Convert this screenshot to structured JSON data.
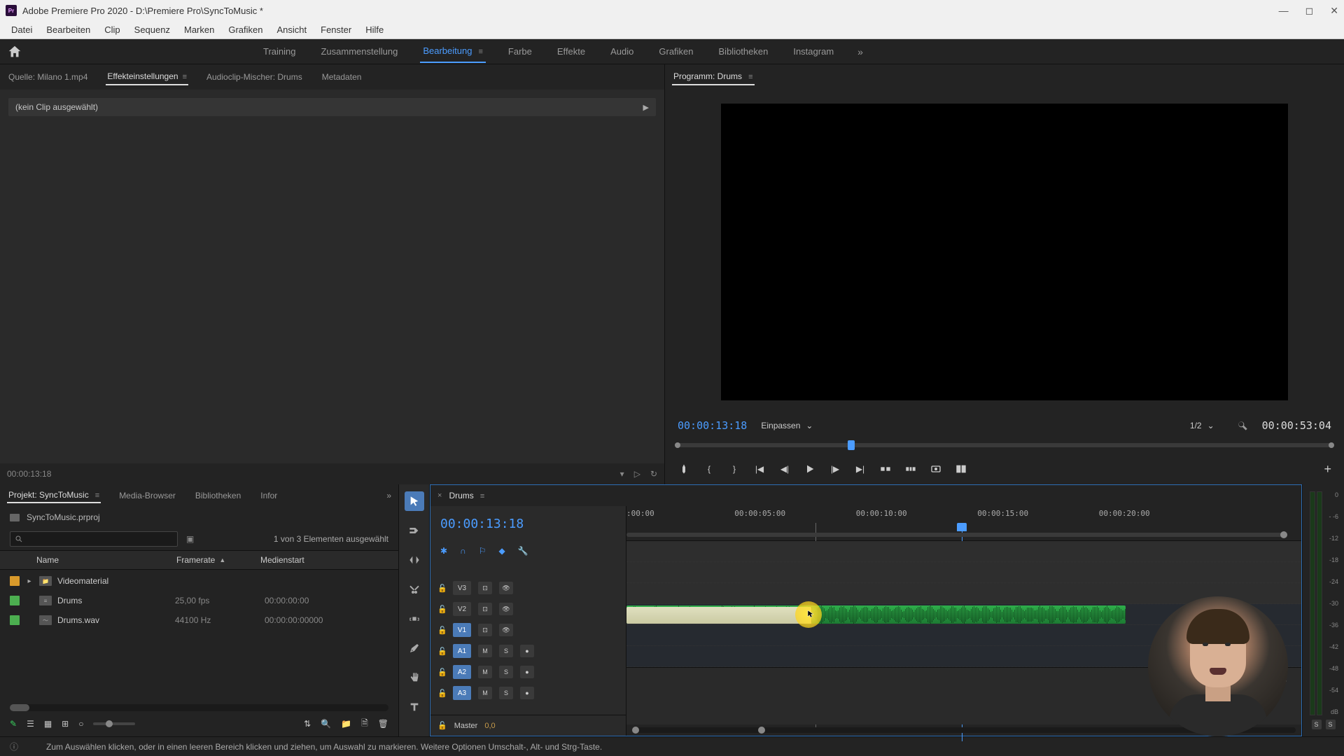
{
  "titlebar": {
    "app_icon_text": "Pr",
    "title": "Adobe Premiere Pro 2020 - D:\\Premiere Pro\\SyncToMusic *"
  },
  "menu": [
    "Datei",
    "Bearbeiten",
    "Clip",
    "Sequenz",
    "Marken",
    "Grafiken",
    "Ansicht",
    "Fenster",
    "Hilfe"
  ],
  "workspaces": [
    "Training",
    "Zusammenstellung",
    "Bearbeitung",
    "Farbe",
    "Effekte",
    "Audio",
    "Grafiken",
    "Bibliotheken",
    "Instagram"
  ],
  "workspace_active_index": 2,
  "source_tabs": {
    "items": [
      "Quelle: Milano 1.mp4",
      "Effekteinstellungen",
      "Audioclip-Mischer: Drums",
      "Metadaten"
    ],
    "active_index": 1,
    "no_clip_text": "(kein Clip ausgewählt)",
    "footer_timecode": "00:00:13:18"
  },
  "program": {
    "tab_label": "Programm: Drums",
    "timecode_current": "00:00:13:18",
    "fit_label": "Einpassen",
    "zoom_label": "1/2",
    "timecode_duration": "00:00:53:04"
  },
  "project": {
    "tabs": [
      "Projekt: SyncToMusic",
      "Media-Browser",
      "Bibliotheken",
      "Infor"
    ],
    "active_index": 0,
    "file_name": "SyncToMusic.prproj",
    "selection_text": "1 von 3 Elementen ausgewählt",
    "columns": {
      "name": "Name",
      "fps": "Framerate",
      "start": "Medienstart"
    },
    "rows": [
      {
        "color": "orange",
        "expandable": true,
        "icon": "folder",
        "name": "Videomaterial",
        "fps": "",
        "start": ""
      },
      {
        "color": "green",
        "expandable": false,
        "icon": "sequence",
        "name": "Drums",
        "fps": "25,00 fps",
        "start": "00:00:00:00"
      },
      {
        "color": "green",
        "expandable": false,
        "icon": "audio",
        "name": "Drums.wav",
        "fps": "44100  Hz",
        "start": "00:00:00:00000"
      }
    ]
  },
  "timeline": {
    "tab_label": "Drums",
    "timecode": "00:00:13:18",
    "ruler_ticks": [
      {
        "label": ":00:00",
        "pct": 0
      },
      {
        "label": "00:00:05:00",
        "pct": 16
      },
      {
        "label": "00:00:10:00",
        "pct": 34
      },
      {
        "label": "00:00:15:00",
        "pct": 52
      },
      {
        "label": "00:00:20:00",
        "pct": 70
      }
    ],
    "playhead_pct": 49,
    "end_marker_pct": 28,
    "video_tracks": [
      {
        "label": "V3",
        "targeted": false
      },
      {
        "label": "V2",
        "targeted": false
      },
      {
        "label": "V1",
        "targeted": true
      }
    ],
    "audio_tracks": [
      {
        "label": "A1",
        "targeted": true
      },
      {
        "label": "A2",
        "targeted": true
      },
      {
        "label": "A3",
        "targeted": true
      }
    ],
    "master_label": "Master",
    "master_value": "0,0",
    "click_highlight_pct": 27
  },
  "meters": {
    "scale": [
      "0",
      "- -6",
      "-12",
      "-18",
      "-24",
      "-30",
      "-36",
      "-42",
      "-48",
      "-54",
      "dB"
    ],
    "solo_labels": [
      "S",
      "S"
    ]
  },
  "status": {
    "text": "Zum Auswählen klicken, oder in einen leeren Bereich klicken und ziehen, um Auswahl zu markieren. Weitere Optionen Umschalt-, Alt- und Strg-Taste."
  }
}
